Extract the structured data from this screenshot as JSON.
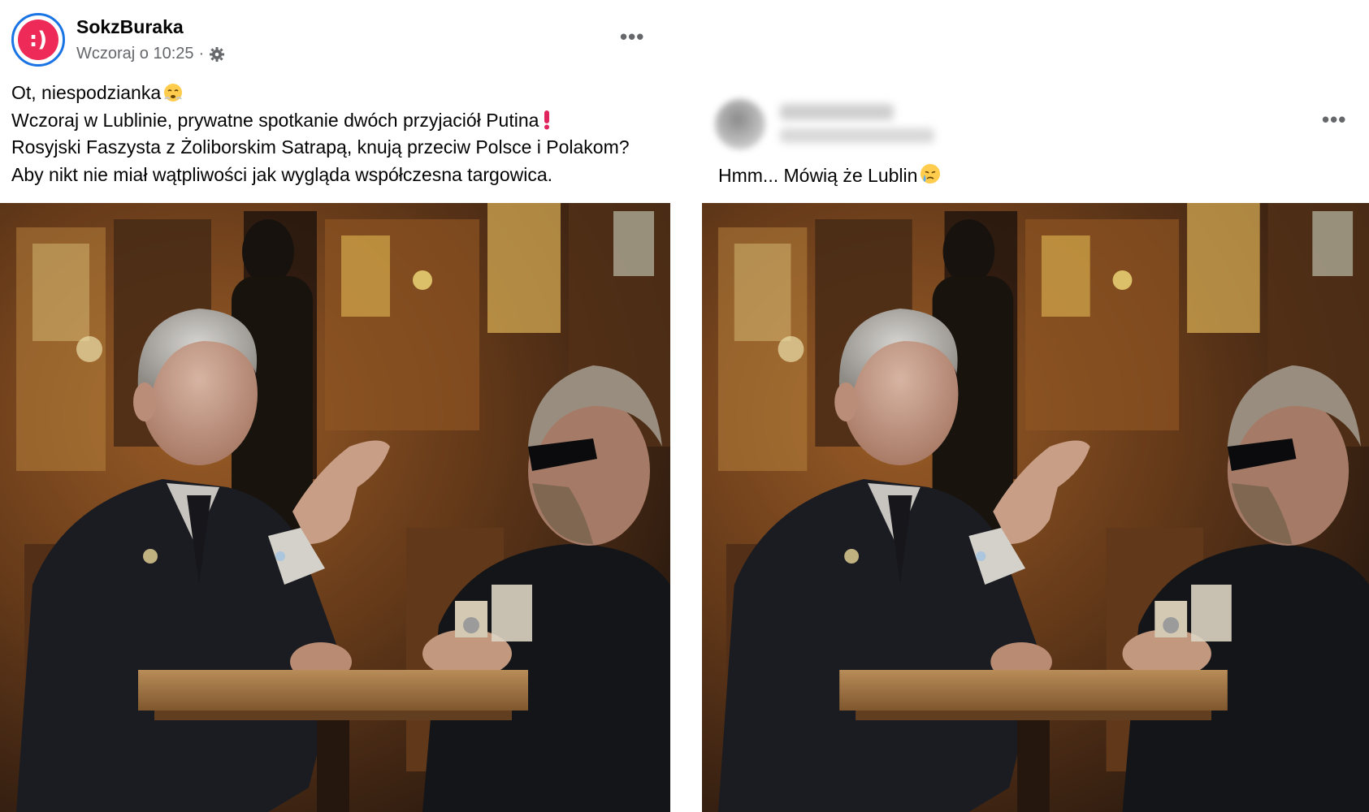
{
  "left_post": {
    "author": "SokzBuraka",
    "avatar_text": ":)",
    "timestamp": "Wczoraj o 10:25",
    "separator": "·",
    "more_label": "•••",
    "lines": [
      "Ot, niespodzianka",
      "Wczoraj w Lublinie, prywatne spotkanie dwóch przyjaciół Putina",
      "Rosyjski Faszysta z Żoliborskim Satrapą, knują przeciw Polsce i Polakom?",
      "Aby nikt nie miał wątpliwości jak wygląda współczesna targowica."
    ],
    "icons": [
      "public-gear-icon",
      "steaming-face-emoji",
      "exclamation-emoji",
      "more-options-icon"
    ]
  },
  "right_post": {
    "more_label": "•••",
    "text": "Hmm... Mówią że Lublin",
    "icons": [
      "crying-face-emoji",
      "more-options-icon"
    ]
  },
  "colors": {
    "avatar_bg": "#ee2a58",
    "avatar_ring": "#1b74e4",
    "meta_text": "#65676b",
    "exclamation": "#e0245e"
  }
}
